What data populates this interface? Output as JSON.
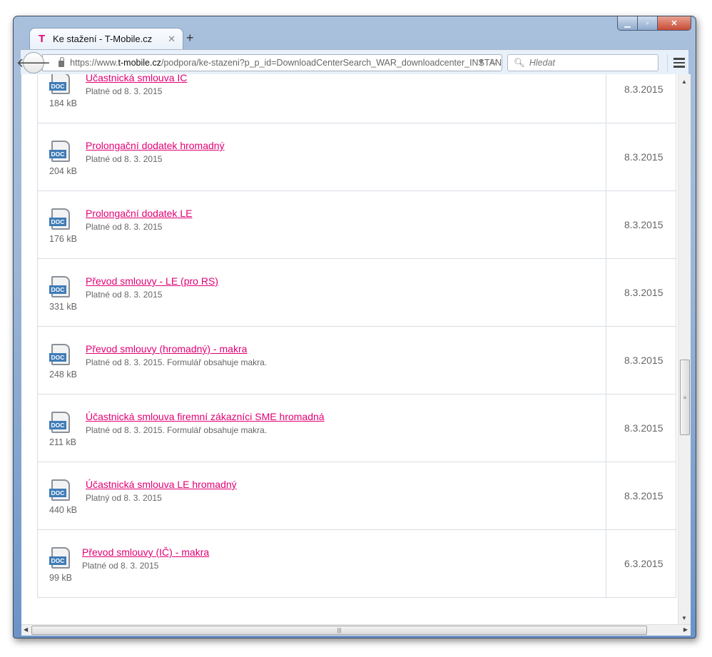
{
  "browser": {
    "tab_title": "Ke stažení - T-Mobile.cz",
    "tab_logo": "T",
    "url_prefix": "https://www.",
    "url_domain": "t-mobile.cz",
    "url_path": "/podpora/ke-stazeni?p_p_id=DownloadCenterSearch_WAR_downloadcenter_INSTAN",
    "search_placeholder": "Hledat"
  },
  "colors": {
    "link": "#e20074",
    "doc_label": "#3f7cb8"
  },
  "documents": [
    {
      "title": "Účastnická smlouva IČ",
      "note": "Platné od 8. 3. 2015",
      "size": "184 kB",
      "date": "8.3.2015",
      "icon": "DOC"
    },
    {
      "title": "Prolongační dodatek hromadný",
      "note": "Platné od 8. 3. 2015",
      "size": "204 kB",
      "date": "8.3.2015",
      "icon": "DOC"
    },
    {
      "title": "Prolongační dodatek LE",
      "note": "Platné od 8. 3. 2015",
      "size": "176 kB",
      "date": "8.3.2015",
      "icon": "DOC"
    },
    {
      "title": "Převod smlouvy - LE (pro RS)",
      "note": "Platné od 8. 3. 2015",
      "size": "331 kB",
      "date": "8.3.2015",
      "icon": "DOC"
    },
    {
      "title": "Převod smlouvy (hromadný) - makra",
      "note": "Platné od 8. 3. 2015. Formulář obsahuje makra.",
      "size": "248 kB",
      "date": "8.3.2015",
      "icon": "DOC"
    },
    {
      "title": "Účastnická smlouva firemní zákazníci SME hromadná",
      "note": "Platné od 8. 3. 2015. Formulář obsahuje makra.",
      "size": "211 kB",
      "date": "8.3.2015",
      "icon": "DOC"
    },
    {
      "title": "Účastnická smlouva LE hromadný",
      "note": "Platný od 8. 3. 2015",
      "size": "440 kB",
      "date": "8.3.2015",
      "icon": "DOC"
    },
    {
      "title": "Převod smlouvy (IČ) - makra",
      "note": "Platné od 8. 3. 2015",
      "size": "99 kB",
      "date": "6.3.2015",
      "icon": "DOC"
    }
  ]
}
